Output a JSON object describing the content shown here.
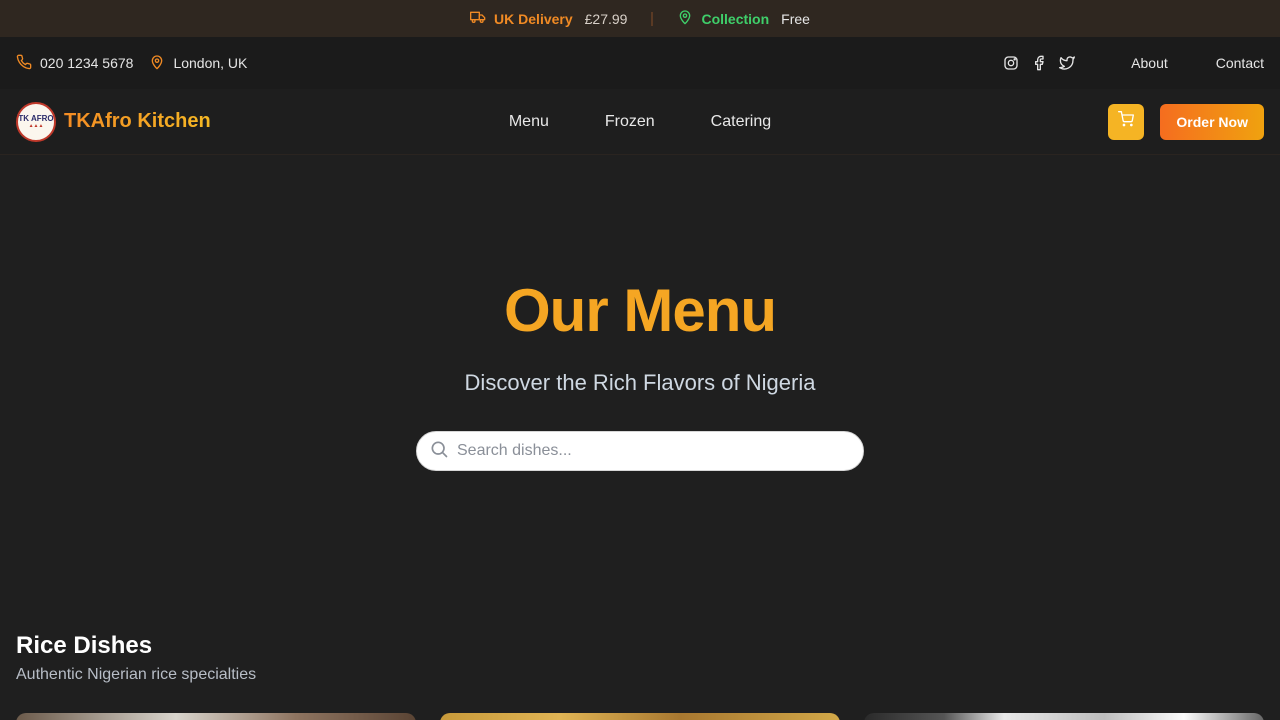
{
  "announcement": {
    "delivery_label": "UK Delivery",
    "delivery_price": "£27.99",
    "collection_label": "Collection",
    "collection_price": "Free"
  },
  "utility": {
    "phone": "020 1234 5678",
    "location": "London, UK",
    "social": [
      "instagram-icon",
      "facebook-icon",
      "twitter-icon"
    ],
    "links": [
      "About",
      "Contact"
    ]
  },
  "nav": {
    "brand": "TKAfro Kitchen",
    "logo_text": "TK AFRO",
    "links": [
      "Menu",
      "Frozen",
      "Catering"
    ],
    "order_label": "Order Now"
  },
  "hero": {
    "title": "Our Menu",
    "subtitle": "Discover the Rich Flavors of Nigeria",
    "search_placeholder": "Search dishes..."
  },
  "section": {
    "title": "Rice Dishes",
    "subtitle": "Authentic Nigerian rice specialties"
  },
  "colors": {
    "accent_orange": "#f5a623",
    "order_gradient_start": "#f56d1f",
    "order_gradient_end": "#f0a20f",
    "collection_green": "#3fcf6a",
    "background": "#1f1f1f"
  }
}
